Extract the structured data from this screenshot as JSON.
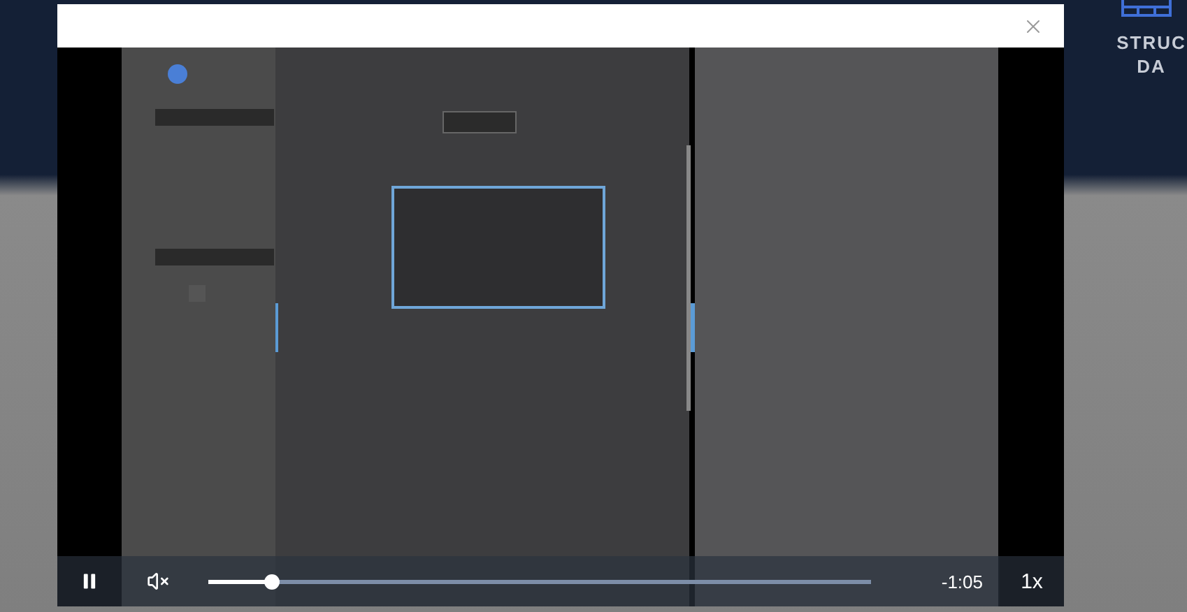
{
  "background": {
    "heading_lines": [
      "STRUC",
      "DA"
    ]
  },
  "video_player": {
    "playing": true,
    "muted": true,
    "progress": {
      "level": 0.095
    },
    "time": "-1:05",
    "speed": "1x"
  }
}
